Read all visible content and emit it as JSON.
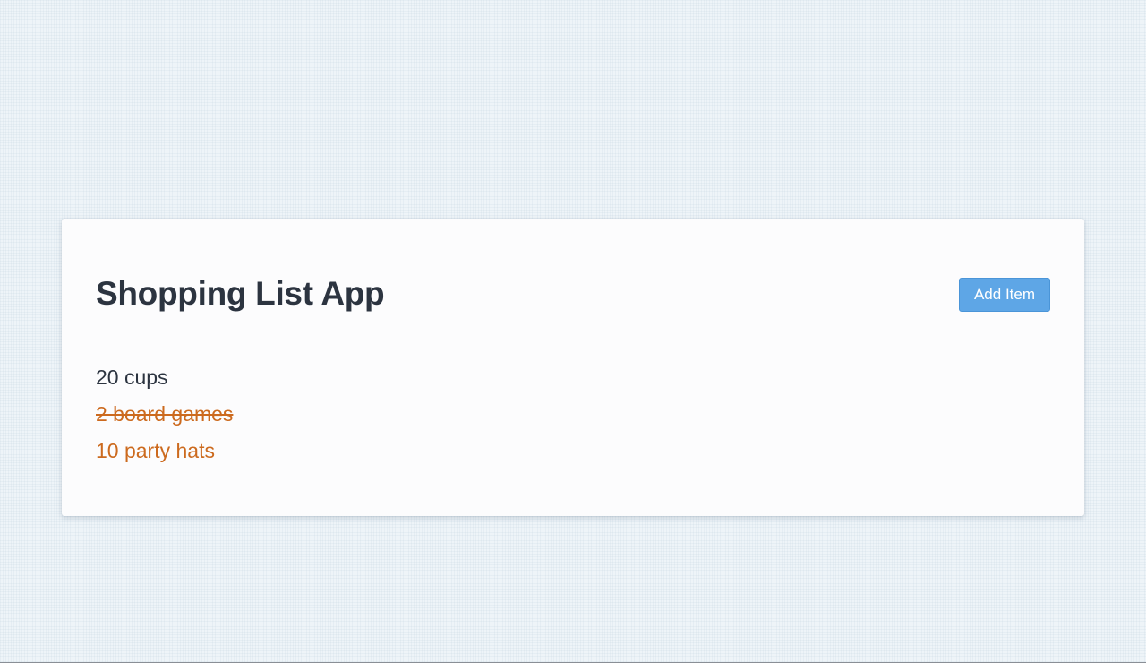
{
  "app": {
    "title": "Shopping List App",
    "add_button_label": "Add Item"
  },
  "items": [
    {
      "label": "20 cups",
      "purchased": false,
      "high_priority": false
    },
    {
      "label": "2 board games",
      "purchased": true,
      "high_priority": true
    },
    {
      "label": "10 party hats",
      "purchased": false,
      "high_priority": true
    }
  ],
  "colors": {
    "background": "#eef4f8",
    "card": "#fcfcfd",
    "text": "#2c3440",
    "priority_text": "#cc6a1e",
    "button": "#5ea6e6"
  }
}
